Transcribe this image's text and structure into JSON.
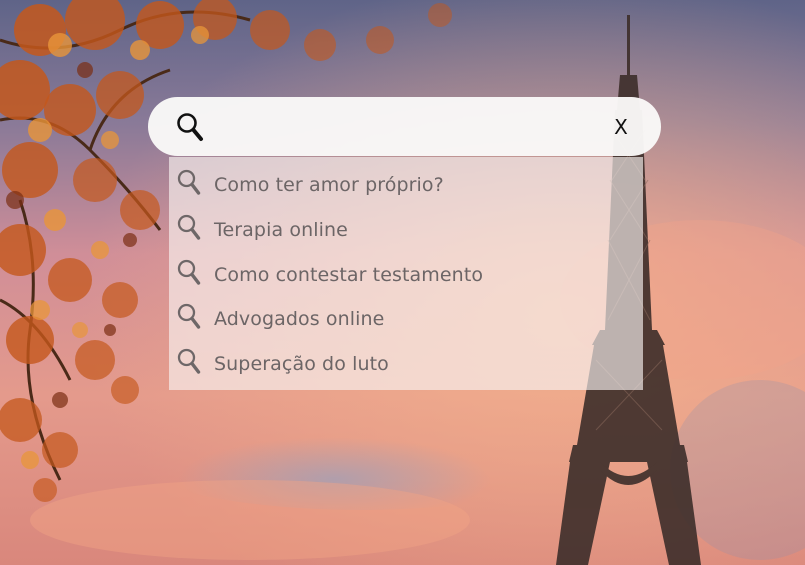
{
  "search": {
    "value": "",
    "placeholder": "",
    "clear_label": "X",
    "search_icon": "search-icon",
    "suggestion_icon": "search-icon"
  },
  "suggestions": [
    {
      "label": "Como ter amor próprio?"
    },
    {
      "label": "Terapia online"
    },
    {
      "label": "Como contestar testamento"
    },
    {
      "label": "Advogados online"
    },
    {
      "label": "Superação do luto"
    }
  ],
  "background": {
    "subject": "eiffel-tower-autumn-sunset",
    "colors": {
      "sky_top": "#6e6c8a",
      "sky_mid": "#d88f8f",
      "sky_glow": "#f0a48a",
      "leaves": "#c25a1c",
      "tower": "#3b2c28"
    }
  }
}
